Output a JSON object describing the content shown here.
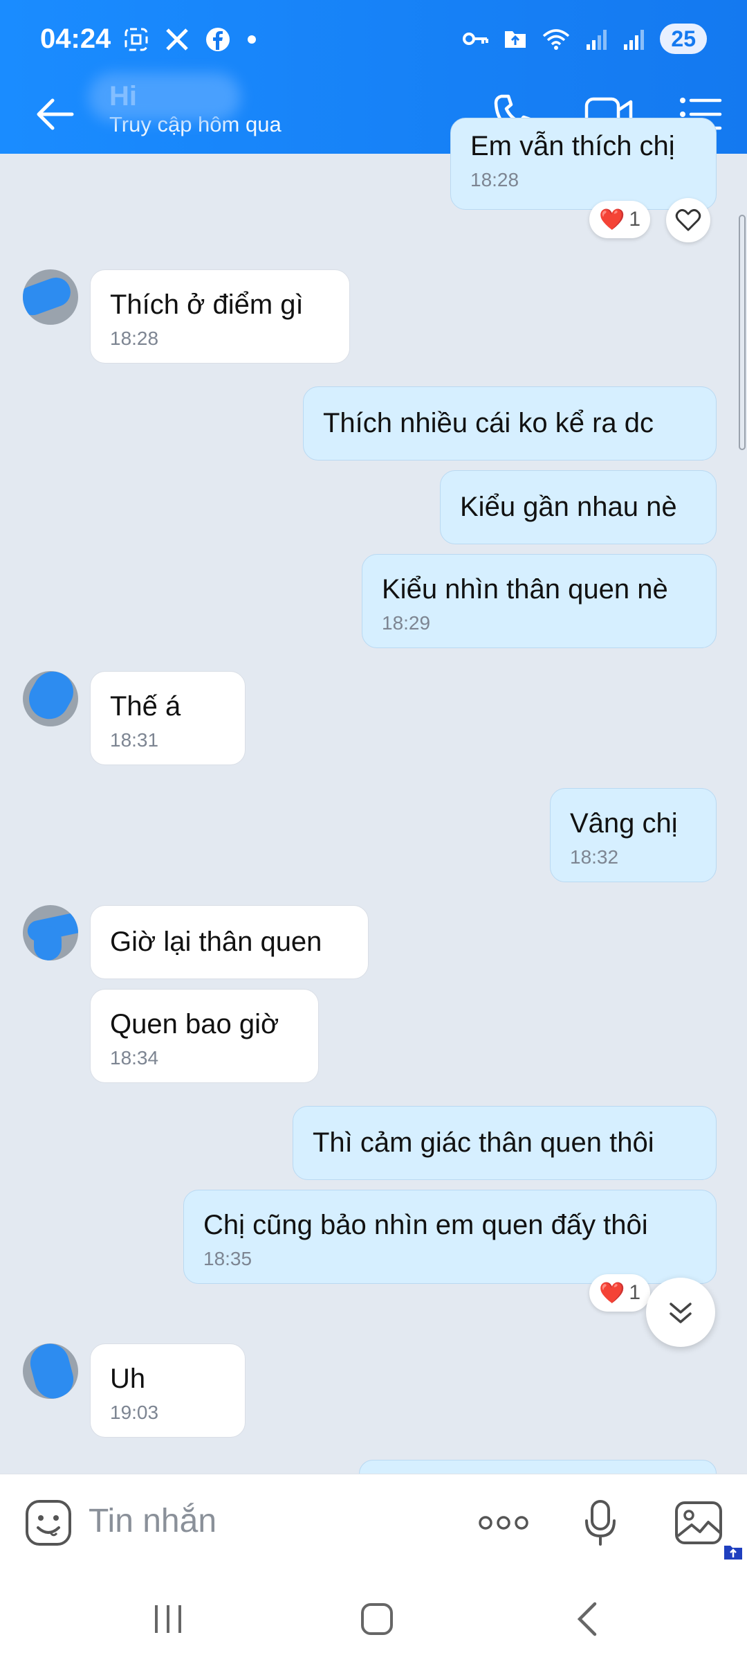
{
  "status_bar": {
    "time": "04:24",
    "battery": "25"
  },
  "header": {
    "name": "Hi",
    "last_seen": "Truy cập hôm qua"
  },
  "messages": [
    {
      "dir": "out",
      "text": "Em vẫn thích chị",
      "time": "18:28"
    },
    {
      "dir": "in",
      "text": "Thích ở điểm gì",
      "time": "18:28"
    },
    {
      "dir": "out",
      "text": "Thích nhiều cái ko kể ra dc"
    },
    {
      "dir": "out",
      "text": "Kiểu gần nhau nè"
    },
    {
      "dir": "out",
      "text": "Kiểu nhìn thân quen nè",
      "time": "18:29"
    },
    {
      "dir": "in",
      "text": "Thế á",
      "time": "18:31"
    },
    {
      "dir": "out",
      "text": "Vâng chị",
      "time": "18:32"
    },
    {
      "dir": "in",
      "text": "Giờ  lại thân quen"
    },
    {
      "dir": "in",
      "text": "Quen bao giờ",
      "time": "18:34"
    },
    {
      "dir": "out",
      "text": "Thì cảm giác thân quen thôi"
    },
    {
      "dir": "out",
      "text": "Chị cũng bảo nhìn em quen đấy thôi",
      "time": "18:35"
    },
    {
      "dir": "in",
      "text": "Uh",
      "time": "19:03"
    }
  ],
  "reactions": [
    {
      "emoji": "❤️",
      "count": "1"
    },
    {
      "emoji": "❤️",
      "count": "1"
    }
  ],
  "input": {
    "placeholder": "Tin nhắn"
  },
  "icons": [
    "back-arrow-icon",
    "phone-icon",
    "video-icon",
    "menu-list-icon",
    "emoji-icon",
    "more-icon",
    "mic-icon",
    "image-icon",
    "heart-icon",
    "chevron-double-down-icon"
  ]
}
